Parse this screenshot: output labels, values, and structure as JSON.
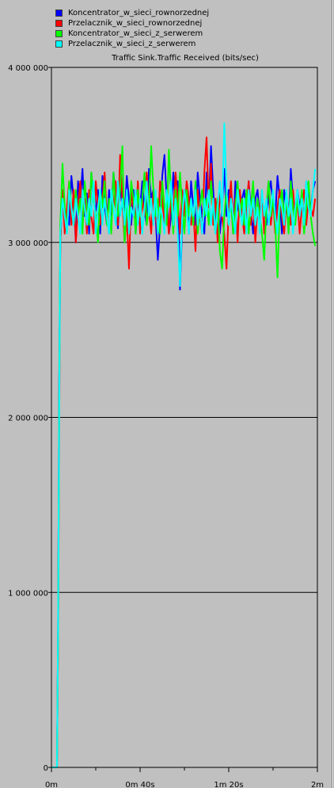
{
  "chart_data": {
    "type": "line",
    "title": "Traffic Sink.Traffic Received (bits/sec)",
    "ylim": [
      0,
      4000000
    ],
    "xlim": [
      0,
      120
    ],
    "y_ticks": [
      {
        "value": 0,
        "label": "0"
      },
      {
        "value": 1000000,
        "label": "1 000 000"
      },
      {
        "value": 2000000,
        "label": "2 000 000"
      },
      {
        "value": 3000000,
        "label": "3 000 000"
      },
      {
        "value": 4000000,
        "label": "4 000 000"
      }
    ],
    "x_ticks": [
      {
        "value": 0,
        "label": "0m"
      },
      {
        "value": 40,
        "label": "0m 40s"
      },
      {
        "value": 80,
        "label": "1m 20s"
      },
      {
        "value": 120,
        "label": "2m"
      }
    ],
    "x_minor_ticks": [
      20,
      60,
      100
    ],
    "grid": "horizontal",
    "legend_position": "top",
    "series": [
      {
        "name": "Koncentrator_w_sieci_rownorzednej",
        "color": "#0000ff",
        "x": [
          0,
          2.5,
          3,
          3.5,
          4,
          5,
          6,
          7,
          8,
          9,
          10,
          11,
          12,
          13,
          14,
          15,
          16,
          17,
          18,
          19,
          20,
          21,
          22,
          23,
          24,
          25,
          26,
          27,
          28,
          29,
          30,
          31,
          32,
          33,
          34,
          35,
          36,
          37,
          38,
          39,
          40,
          41,
          42,
          43,
          44,
          45,
          46,
          47,
          48,
          49,
          50,
          51,
          52,
          53,
          54,
          55,
          56,
          57,
          58,
          59,
          60,
          61,
          62,
          63,
          64,
          65,
          66,
          67,
          68,
          69,
          70,
          71,
          72,
          73,
          74,
          75,
          76,
          77,
          78,
          79,
          80,
          81,
          82,
          83,
          84,
          85,
          86,
          87,
          88,
          89,
          90,
          91,
          92,
          93,
          94,
          95,
          96,
          97,
          98,
          99,
          100,
          101,
          102,
          103,
          104,
          105,
          106,
          107,
          108,
          109,
          110,
          111,
          112,
          113,
          114,
          115,
          116,
          117,
          118,
          119
        ],
        "y": [
          0,
          0,
          800000,
          2200000,
          3000000,
          3280000,
          3120000,
          3180000,
          3100000,
          3380000,
          3250000,
          3000000,
          3350000,
          3220000,
          3420000,
          3150000,
          3280000,
          3050000,
          3400000,
          3250000,
          3180000,
          3300000,
          3050000,
          3380000,
          3220000,
          3100000,
          3300000,
          3150000,
          3400000,
          3250000,
          3080000,
          3330000,
          3200000,
          3150000,
          3380000,
          3250000,
          3100000,
          3300000,
          3050000,
          3250000,
          3200000,
          3350000,
          3180000,
          3100000,
          3420000,
          3250000,
          3300000,
          3150000,
          2900000,
          3100000,
          3380000,
          3500000,
          3250000,
          3050000,
          3150000,
          3400000,
          3200000,
          3350000,
          2730000,
          3100000,
          3300000,
          3250000,
          3050000,
          3350000,
          3200000,
          3100000,
          3400000,
          3250000,
          3150000,
          3050000,
          3400000,
          3200000,
          3550000,
          3300000,
          3100000,
          3250000,
          3050000,
          3200000,
          3420000,
          3150000,
          3300000,
          3250000,
          3050000,
          3350000,
          3200000,
          3150000,
          3250000,
          3300000,
          3100000,
          3350000,
          3180000,
          3050000,
          3250000,
          3300000,
          3150000,
          3250000,
          3180000,
          3100000,
          3280000,
          3350000,
          3200000,
          3150000,
          3380000,
          3250000,
          3050000,
          3300000,
          3200000,
          3100000,
          3420000,
          3250000,
          3150000,
          3300000,
          3200000,
          3280000,
          3100000,
          3350000,
          3250000,
          3180000,
          3300000,
          3350000
        ]
      },
      {
        "name": "Przelacznik_w_sieci_rownorzednej",
        "color": "#ff0000",
        "x": [
          0,
          2.5,
          3,
          3.5,
          4,
          5,
          6,
          7,
          8,
          9,
          10,
          11,
          12,
          13,
          14,
          15,
          16,
          17,
          18,
          19,
          20,
          21,
          22,
          23,
          24,
          25,
          26,
          27,
          28,
          29,
          30,
          31,
          32,
          33,
          34,
          35,
          36,
          37,
          38,
          39,
          40,
          41,
          42,
          43,
          44,
          45,
          46,
          47,
          48,
          49,
          50,
          51,
          52,
          53,
          54,
          55,
          56,
          57,
          58,
          59,
          60,
          61,
          62,
          63,
          64,
          65,
          66,
          67,
          68,
          69,
          70,
          71,
          72,
          73,
          74,
          75,
          76,
          77,
          78,
          79,
          80,
          81,
          82,
          83,
          84,
          85,
          86,
          87,
          88,
          89,
          90,
          91,
          92,
          93,
          94,
          95,
          96,
          97,
          98,
          99,
          100,
          101,
          102,
          103,
          104,
          105,
          106,
          107,
          108,
          109,
          110,
          111,
          112,
          113,
          114,
          115,
          116,
          117,
          118,
          119
        ],
        "y": [
          0,
          0,
          700000,
          1900000,
          3000000,
          3300000,
          3050000,
          3200000,
          3350000,
          3100000,
          3300000,
          3000000,
          3200000,
          3350000,
          3100000,
          3250000,
          3050000,
          3300000,
          3150000,
          3050000,
          3350000,
          3200000,
          3100000,
          3250000,
          3400000,
          3150000,
          3050000,
          3300000,
          3200000,
          3350000,
          3100000,
          3500000,
          3250000,
          3000000,
          3150000,
          2850000,
          3300000,
          3200000,
          3100000,
          3350000,
          3050000,
          3250000,
          3150000,
          3400000,
          3200000,
          3050000,
          3300000,
          3150000,
          3050000,
          3350000,
          3250000,
          3100000,
          3200000,
          3050000,
          3300000,
          3150000,
          3400000,
          3250000,
          3050000,
          3300000,
          3150000,
          3350000,
          3250000,
          3100000,
          3200000,
          2950000,
          3300000,
          3150000,
          3050000,
          3400000,
          3600000,
          3200000,
          3450000,
          3100000,
          3250000,
          3000000,
          3300000,
          3150000,
          3050000,
          2850000,
          3200000,
          3350000,
          3100000,
          3250000,
          3000000,
          3300000,
          3150000,
          3050000,
          3200000,
          3350000,
          3100000,
          3250000,
          3000000,
          3200000,
          3150000,
          3300000,
          3050000,
          3200000,
          3350000,
          3100000,
          3250000,
          3050000,
          3200000,
          3300000,
          3150000,
          3050000,
          3250000,
          3200000,
          3100000,
          3300000,
          3150000,
          3250000,
          3050000,
          3200000,
          3300000,
          3100000,
          3250000,
          3200000,
          3150000,
          3250000
        ]
      },
      {
        "name": "Koncentrator_w_sieci_z_serwerem",
        "color": "#00ff00",
        "x": [
          0,
          2.5,
          3,
          3.5,
          4,
          5,
          6,
          7,
          8,
          9,
          10,
          11,
          12,
          13,
          14,
          15,
          16,
          17,
          18,
          19,
          20,
          21,
          22,
          23,
          24,
          25,
          26,
          27,
          28,
          29,
          30,
          31,
          32,
          33,
          34,
          35,
          36,
          37,
          38,
          39,
          40,
          41,
          42,
          43,
          44,
          45,
          46,
          47,
          48,
          49,
          50,
          51,
          52,
          53,
          54,
          55,
          56,
          57,
          58,
          59,
          60,
          61,
          62,
          63,
          64,
          65,
          66,
          67,
          68,
          69,
          70,
          71,
          72,
          73,
          74,
          75,
          76,
          77,
          78,
          79,
          80,
          81,
          82,
          83,
          84,
          85,
          86,
          87,
          88,
          89,
          90,
          91,
          92,
          93,
          94,
          95,
          96,
          97,
          98,
          99,
          100,
          101,
          102,
          103,
          104,
          105,
          106,
          107,
          108,
          109,
          110,
          111,
          112,
          113,
          114,
          115,
          116,
          117,
          118,
          119
        ],
        "y": [
          0,
          0,
          750000,
          2100000,
          3100000,
          3450000,
          3200000,
          3050000,
          3350000,
          3200000,
          3100000,
          3300000,
          3150000,
          3250000,
          3050000,
          3350000,
          3200000,
          3100000,
          3400000,
          3250000,
          3150000,
          3000000,
          3300000,
          3200000,
          3350000,
          3100000,
          3250000,
          3050000,
          3400000,
          3200000,
          3150000,
          3300000,
          3550000,
          3000000,
          3200000,
          3100000,
          3350000,
          3250000,
          3050000,
          3300000,
          3150000,
          3250000,
          3400000,
          3100000,
          3200000,
          3550000,
          3300000,
          3150000,
          3250000,
          3050000,
          3350000,
          3200000,
          3100000,
          3530000,
          3250000,
          3050000,
          3300000,
          3150000,
          3400000,
          3200000,
          3050000,
          3300000,
          3150000,
          3250000,
          3100000,
          3350000,
          3050000,
          3200000,
          3300000,
          3150000,
          3250000,
          3100000,
          3350000,
          3200000,
          3050000,
          3250000,
          2950000,
          2850000,
          3150000,
          3300000,
          3100000,
          3250000,
          3050000,
          3200000,
          3350000,
          3150000,
          3250000,
          3100000,
          3300000,
          3050000,
          3200000,
          3350000,
          3100000,
          3250000,
          3150000,
          3050000,
          2900000,
          3200000,
          3350000,
          3150000,
          3250000,
          3100000,
          2800000,
          3200000,
          3300000,
          3150000,
          3250000,
          3050000,
          3350000,
          3200000,
          3100000,
          3250000,
          3150000,
          3300000,
          3050000,
          3200000,
          3350000,
          3150000,
          3050000,
          2980000
        ]
      },
      {
        "name": "Przelacznik_w_sieci_z_serwerem",
        "color": "#00ffff",
        "x": [
          0,
          2.5,
          3,
          3.5,
          4,
          5,
          6,
          7,
          8,
          9,
          10,
          11,
          12,
          13,
          14,
          15,
          16,
          17,
          18,
          19,
          20,
          21,
          22,
          23,
          24,
          25,
          26,
          27,
          28,
          29,
          30,
          31,
          32,
          33,
          34,
          35,
          36,
          37,
          38,
          39,
          40,
          41,
          42,
          43,
          44,
          45,
          46,
          47,
          48,
          49,
          50,
          51,
          52,
          53,
          54,
          55,
          56,
          57,
          58,
          59,
          60,
          61,
          62,
          63,
          64,
          65,
          66,
          67,
          68,
          69,
          70,
          71,
          72,
          73,
          74,
          75,
          76,
          77,
          78,
          79,
          80,
          81,
          82,
          83,
          84,
          85,
          86,
          87,
          88,
          89,
          90,
          91,
          92,
          93,
          94,
          95,
          96,
          97,
          98,
          99,
          100,
          101,
          102,
          103,
          104,
          105,
          106,
          107,
          108,
          109,
          110,
          111,
          112,
          113,
          114,
          115,
          116,
          117,
          118,
          119
        ],
        "y": [
          0,
          0,
          800000,
          2000000,
          3050000,
          3250000,
          3150000,
          3050000,
          3300000,
          3200000,
          3100000,
          3250000,
          3150000,
          3050000,
          3300000,
          3200000,
          3100000,
          3250000,
          3150000,
          3350000,
          3050000,
          3200000,
          3300000,
          3100000,
          3250000,
          3150000,
          3050000,
          3300000,
          3200000,
          3100000,
          3350000,
          3150000,
          3250000,
          3100000,
          3300000,
          3050000,
          3200000,
          3150000,
          3300000,
          3100000,
          3250000,
          3050000,
          3200000,
          3350000,
          3150000,
          3250000,
          3100000,
          3300000,
          3050000,
          3200000,
          3150000,
          3050000,
          3300000,
          3200000,
          3350000,
          3100000,
          3250000,
          3050000,
          2750000,
          3150000,
          3300000,
          3200000,
          3050000,
          3250000,
          3150000,
          3300000,
          3100000,
          3200000,
          3050000,
          3250000,
          3150000,
          3300000,
          3100000,
          3250000,
          3050000,
          3200000,
          3350000,
          3150000,
          3680000,
          3300000,
          3100000,
          3250000,
          3150000,
          3050000,
          3300000,
          3200000,
          3100000,
          3250000,
          3050000,
          3300000,
          3150000,
          3250000,
          3100000,
          3200000,
          3050000,
          3300000,
          3150000,
          3250000,
          3100000,
          3200000,
          3300000,
          3150000,
          3050000,
          3250000,
          3200000,
          3100000,
          3300000,
          3150000,
          3250000,
          3050000,
          3200000,
          3300000,
          3150000,
          3250000,
          3100000,
          3350000,
          3200000,
          3150000,
          3300000,
          3420000
        ]
      }
    ]
  }
}
